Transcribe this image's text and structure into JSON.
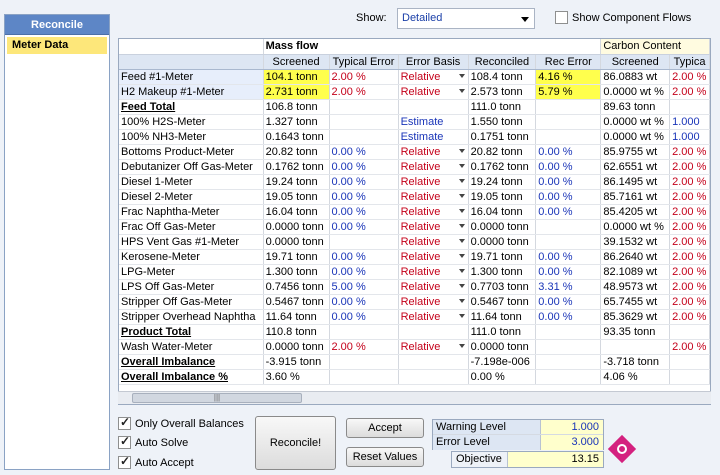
{
  "sidebar": {
    "header": "Reconcile",
    "items": [
      "Meter Data"
    ]
  },
  "toolbar": {
    "show_label": "Show:",
    "show_value": "Detailed",
    "component_flows_label": "Show Component Flows"
  },
  "grid": {
    "groups": {
      "mass_flow": "Mass flow",
      "carbon_content": "Carbon Content"
    },
    "columns": [
      "Screened",
      "Typical Error",
      "Error Basis",
      "Reconciled",
      "Rec Error",
      "Screened",
      "Typica"
    ],
    "rows": [
      {
        "name": "Feed #1-Meter",
        "screened": "104.1 tonn",
        "typ_err": "2.00 %",
        "basis": "Relative",
        "recon": "108.4 tonn",
        "rec_err": "4.16 %",
        "c_screened": "86.0883 wt",
        "c_typ": "2.00 %"
      },
      {
        "name": "H2 Makeup #1-Meter",
        "screened": "2.731 tonn",
        "typ_err": "2.00 %",
        "basis": "Relative",
        "recon": "2.573 tonn",
        "rec_err": "5.79 %",
        "c_screened": "0.0000 wt %",
        "c_typ": "2.00 %"
      },
      {
        "name": "Feed Total",
        "screened": "106.8 tonn",
        "typ_err": "",
        "basis": "",
        "recon": "111.0 tonn",
        "rec_err": "",
        "c_screened": "89.63 tonn",
        "c_typ": ""
      },
      {
        "name": "100% H2S-Meter",
        "screened": "1.327 tonn",
        "typ_err": "",
        "basis": "Estimate",
        "recon": "1.550 tonn",
        "rec_err": "",
        "c_screened": "0.0000 wt %",
        "c_typ": "1.000"
      },
      {
        "name": "100% NH3-Meter",
        "screened": "0.1643 tonn",
        "typ_err": "",
        "basis": "Estimate",
        "recon": "0.1751 tonn",
        "rec_err": "",
        "c_screened": "0.0000 wt %",
        "c_typ": "1.000"
      },
      {
        "name": "Bottoms Product-Meter",
        "screened": "20.82 tonn",
        "typ_err": "0.00 %",
        "basis": "Relative",
        "recon": "20.82 tonn",
        "rec_err": "0.00 %",
        "c_screened": "85.9755 wt",
        "c_typ": "2.00 %"
      },
      {
        "name": "Debutanizer Off Gas-Meter",
        "screened": "0.1762 tonn",
        "typ_err": "0.00 %",
        "basis": "Relative",
        "recon": "0.1762 tonn",
        "rec_err": "0.00 %",
        "c_screened": "62.6551 wt",
        "c_typ": "2.00 %"
      },
      {
        "name": "Diesel 1-Meter",
        "screened": "19.24 tonn",
        "typ_err": "0.00 %",
        "basis": "Relative",
        "recon": "19.24 tonn",
        "rec_err": "0.00 %",
        "c_screened": "86.1495 wt",
        "c_typ": "2.00 %"
      },
      {
        "name": "Diesel 2-Meter",
        "screened": "19.05 tonn",
        "typ_err": "0.00 %",
        "basis": "Relative",
        "recon": "19.05 tonn",
        "rec_err": "0.00 %",
        "c_screened": "85.7161 wt",
        "c_typ": "2.00 %"
      },
      {
        "name": "Frac Naphtha-Meter",
        "screened": "16.04 tonn",
        "typ_err": "0.00 %",
        "basis": "Relative",
        "recon": "16.04 tonn",
        "rec_err": "0.00 %",
        "c_screened": "85.4205 wt",
        "c_typ": "2.00 %"
      },
      {
        "name": "Frac Off Gas-Meter",
        "screened": "0.0000 tonn",
        "typ_err": "0.00 %",
        "basis": "Relative",
        "recon": "0.0000 tonn",
        "rec_err": "",
        "c_screened": "0.0000 wt %",
        "c_typ": "2.00 %"
      },
      {
        "name": "HPS Vent Gas #1-Meter",
        "screened": "0.0000 tonn",
        "typ_err": "",
        "basis": "Relative",
        "recon": "0.0000 tonn",
        "rec_err": "",
        "c_screened": "39.1532 wt",
        "c_typ": "2.00 %"
      },
      {
        "name": "Kerosene-Meter",
        "screened": "19.71 tonn",
        "typ_err": "0.00 %",
        "basis": "Relative",
        "recon": "19.71 tonn",
        "rec_err": "0.00 %",
        "c_screened": "86.2640 wt",
        "c_typ": "2.00 %"
      },
      {
        "name": "LPG-Meter",
        "screened": "1.300 tonn",
        "typ_err": "0.00 %",
        "basis": "Relative",
        "recon": "1.300 tonn",
        "rec_err": "0.00 %",
        "c_screened": "82.1089 wt",
        "c_typ": "2.00 %"
      },
      {
        "name": "LPS Off Gas-Meter",
        "screened": "0.7456 tonn",
        "typ_err": "5.00 %",
        "basis": "Relative",
        "recon": "0.7703 tonn",
        "rec_err": "3.31 %",
        "c_screened": "48.9573 wt",
        "c_typ": "2.00 %"
      },
      {
        "name": "Stripper Off Gas-Meter",
        "screened": "0.5467 tonn",
        "typ_err": "0.00 %",
        "basis": "Relative",
        "recon": "0.5467 tonn",
        "rec_err": "0.00 %",
        "c_screened": "65.7455 wt",
        "c_typ": "2.00 %"
      },
      {
        "name": "Stripper Overhead Naphtha",
        "screened": "11.64 tonn",
        "typ_err": "0.00 %",
        "basis": "Relative",
        "recon": "11.64 tonn",
        "rec_err": "0.00 %",
        "c_screened": "85.3629 wt",
        "c_typ": "2.00 %"
      },
      {
        "name": "Product Total",
        "screened": "110.8 tonn",
        "typ_err": "",
        "basis": "",
        "recon": "111.0 tonn",
        "rec_err": "",
        "c_screened": "93.35 tonn",
        "c_typ": ""
      },
      {
        "name": "Wash Water-Meter",
        "screened": "0.0000 tonn",
        "typ_err": "2.00 %",
        "basis": "Relative",
        "recon": "0.0000 tonn",
        "rec_err": "",
        "c_screened": "",
        "c_typ": "2.00 %"
      },
      {
        "name": "Overall Imbalance",
        "screened": "-3.915 tonn",
        "typ_err": "",
        "basis": "",
        "recon": "-7.198e-006",
        "rec_err": "",
        "c_screened": "-3.718 tonn",
        "c_typ": ""
      },
      {
        "name": "Overall Imbalance %",
        "screened": "3.60 %",
        "typ_err": "",
        "basis": "",
        "recon": "0.00 %",
        "rec_err": "",
        "c_screened": "4.06 %",
        "c_typ": ""
      }
    ]
  },
  "options": {
    "only_overall": "Only Overall Balances",
    "auto_solve": "Auto Solve",
    "auto_accept": "Auto Accept"
  },
  "buttons": {
    "reconcile": "Reconcile!",
    "accept": "Accept",
    "reset": "Reset Values"
  },
  "levels": {
    "warning_label": "Warning Level",
    "warning_value": "1.000",
    "error_label": "Error Level",
    "error_value": "3.000"
  },
  "objective": {
    "label": "Objective",
    "value": "13.15"
  }
}
